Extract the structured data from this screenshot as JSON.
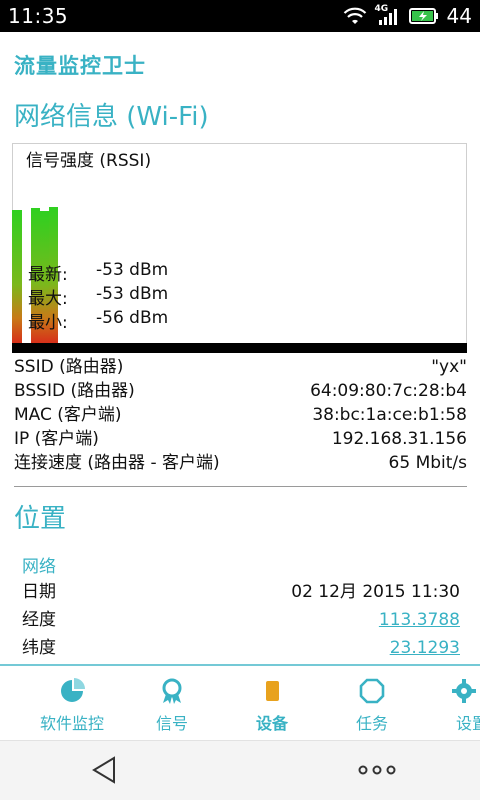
{
  "status_bar": {
    "time": "11:35",
    "network_type": "4G",
    "battery_level": "44",
    "icons": [
      "wifi-icon",
      "cellular-signal-icon",
      "battery-charging-icon"
    ]
  },
  "app": {
    "logo_text": "流量监控卫士"
  },
  "wifi_section": {
    "title": "网络信息 (Wi-Fi)",
    "chart": {
      "title": "信号强度 (RSSI)",
      "stats": [
        {
          "label": "最新:",
          "value": "-53 dBm"
        },
        {
          "label": "最大:",
          "value": "-53 dBm"
        },
        {
          "label": "最小:",
          "value": "-56 dBm"
        }
      ]
    },
    "info": [
      {
        "label": "SSID (路由器)",
        "value": "\"yx\""
      },
      {
        "label": "BSSID (路由器)",
        "value": "64:09:80:7c:28:b4"
      },
      {
        "label": "MAC (客户端)",
        "value": "38:bc:1a:ce:b1:58"
      },
      {
        "label": "IP (客户端)",
        "value": "192.168.31.156"
      },
      {
        "label": "连接速度 (路由器 - 客户端)",
        "value": "65 Mbit/s"
      }
    ]
  },
  "location_section": {
    "title": "位置",
    "subtitle": "网络",
    "rows": [
      {
        "label": "日期",
        "value": "02 12月 2015 11:30"
      },
      {
        "label": "经度",
        "value": "113.3788"
      },
      {
        "label": "纬度",
        "value": "23.1293"
      }
    ]
  },
  "tabs": [
    {
      "label": "软件监控",
      "icon": "pie-chart-icon"
    },
    {
      "label": "信号",
      "icon": "award-badge-icon"
    },
    {
      "label": "设备",
      "icon": "device-icon",
      "active": true
    },
    {
      "label": "任务",
      "icon": "octagon-icon"
    },
    {
      "label": "设置",
      "icon": "gear-icon"
    }
  ],
  "colors": {
    "accent": "#39b2c4",
    "signal_high": "#2fd020",
    "signal_low": "#d82a1a"
  }
}
